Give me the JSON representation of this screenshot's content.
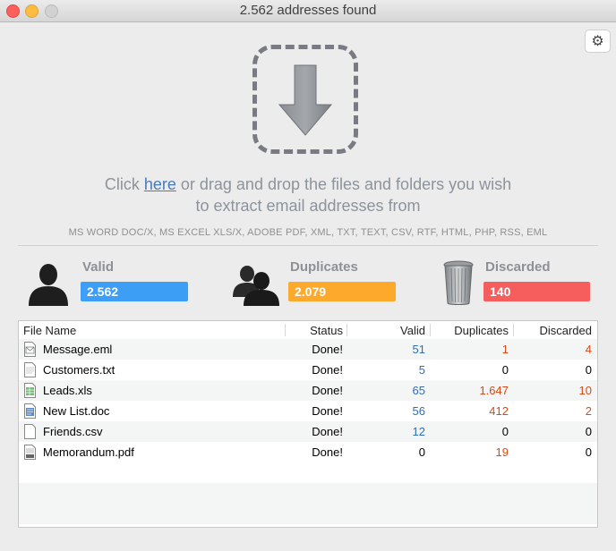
{
  "window": {
    "title": "2.562 addresses found"
  },
  "toolbar": {
    "settings_icon": "gear-icon"
  },
  "dropzone": {
    "icon": "download-arrow-icon",
    "prefix": "Click ",
    "link": "here",
    "suffix": " or drag and drop the files and folders you wish",
    "line2": "to extract email addresses from",
    "formats": "MS WORD DOC/X, MS EXCEL XLS/X, ADOBE PDF, XML, TXT, TEXT, CSV, RTF, HTML, PHP, RSS, EML"
  },
  "stats": {
    "valid": {
      "label": "Valid",
      "value": "2.562",
      "color": "#3d9ef6",
      "icon": "person-icon"
    },
    "duplicates": {
      "label": "Duplicates",
      "value": "2.079",
      "color": "#fdaa2c",
      "icon": "people-icon"
    },
    "discarded": {
      "label": "Discarded",
      "value": "140",
      "color": "#f65d5d",
      "icon": "trash-icon"
    }
  },
  "table": {
    "headers": {
      "file": "File Name",
      "status": "Status",
      "valid": "Valid",
      "duplicates": "Duplicates",
      "discarded": "Discarded"
    },
    "rows": [
      {
        "file": "Message.eml",
        "status": "Done!",
        "valid": "51",
        "duplicates": "1",
        "discarded": "4",
        "icon": "email-file-icon"
      },
      {
        "file": "Customers.txt",
        "status": "Done!",
        "valid": "5",
        "duplicates": "0",
        "discarded": "0",
        "icon": "text-file-icon"
      },
      {
        "file": "Leads.xls",
        "status": "Done!",
        "valid": "65",
        "duplicates": "1.647",
        "discarded": "10",
        "icon": "spreadsheet-file-icon"
      },
      {
        "file": "New List.doc",
        "status": "Done!",
        "valid": "56",
        "duplicates": "412",
        "discarded": "2",
        "icon": "word-file-icon"
      },
      {
        "file": "Friends.csv",
        "status": "Done!",
        "valid": "12",
        "duplicates": "0",
        "discarded": "0",
        "icon": "csv-file-icon"
      },
      {
        "file": "Memorandum.pdf",
        "status": "Done!",
        "valid": "0",
        "duplicates": "19",
        "discarded": "0",
        "icon": "pdf-file-icon"
      }
    ]
  }
}
